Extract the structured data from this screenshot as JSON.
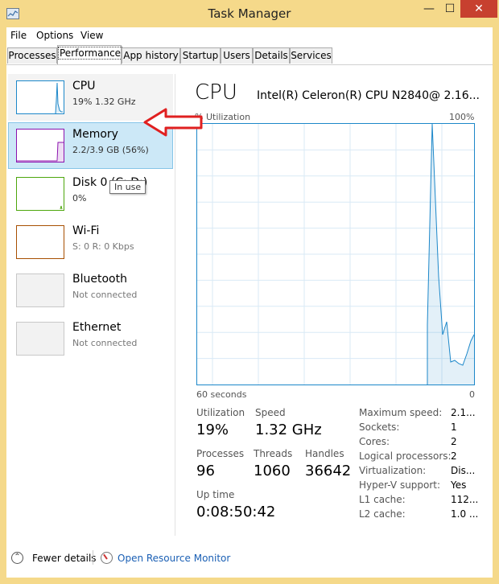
{
  "window": {
    "title": "Task Manager",
    "minimize": "—",
    "maximize": "☐",
    "close": "✕"
  },
  "menu": [
    "File",
    "Options",
    "View"
  ],
  "tabs": [
    "Processes",
    "Performance",
    "App history",
    "Startup",
    "Users",
    "Details",
    "Services"
  ],
  "active_tab": "Performance",
  "sidebar": [
    {
      "name": "CPU",
      "sub": "19%  1.32 GHz",
      "color": "#1c87c9"
    },
    {
      "name": "Memory",
      "sub": "2.2/3.9 GB (56%)",
      "color": "#8b12ae"
    },
    {
      "name": "Disk 0 (C: D:)",
      "sub": "0%",
      "color": "#4da60c"
    },
    {
      "name": "Wi-Fi",
      "sub": "S: 0  R: 0 Kbps",
      "color": "#a74f01"
    },
    {
      "name": "Bluetooth",
      "sub": "Not connected",
      "color": "#bbbbbb"
    },
    {
      "name": "Ethernet",
      "sub": "Not connected",
      "color": "#bbbbbb"
    }
  ],
  "tooltip": "In use",
  "main": {
    "title": "CPU",
    "model": "Intel(R) Celeron(R) CPU N2840@ 2.16...",
    "util_label": "% Utilization",
    "util_max": "100%",
    "axis_left": "60 seconds",
    "axis_right": "0",
    "stats": {
      "utilization_label": "Utilization",
      "utilization": "19%",
      "speed_label": "Speed",
      "speed": "1.32 GHz",
      "processes_label": "Processes",
      "processes": "96",
      "threads_label": "Threads",
      "threads": "1060",
      "handles_label": "Handles",
      "handles": "36642",
      "uptime_label": "Up time",
      "uptime": "0:08:50:42"
    },
    "details": [
      {
        "label": "Maximum speed:",
        "value": "2.1..."
      },
      {
        "label": "Sockets:",
        "value": "1"
      },
      {
        "label": "Cores:",
        "value": "2"
      },
      {
        "label": "Logical processors:",
        "value": "2"
      },
      {
        "label": "Virtualization:",
        "value": "Dis..."
      },
      {
        "label": "Hyper-V support:",
        "value": "Yes"
      },
      {
        "label": "L1 cache:",
        "value": "112..."
      },
      {
        "label": "L2 cache:",
        "value": "1.0 ..."
      }
    ]
  },
  "footer": {
    "fewer_details": "Fewer details",
    "resource_monitor": "Open Resource Monitor"
  }
}
